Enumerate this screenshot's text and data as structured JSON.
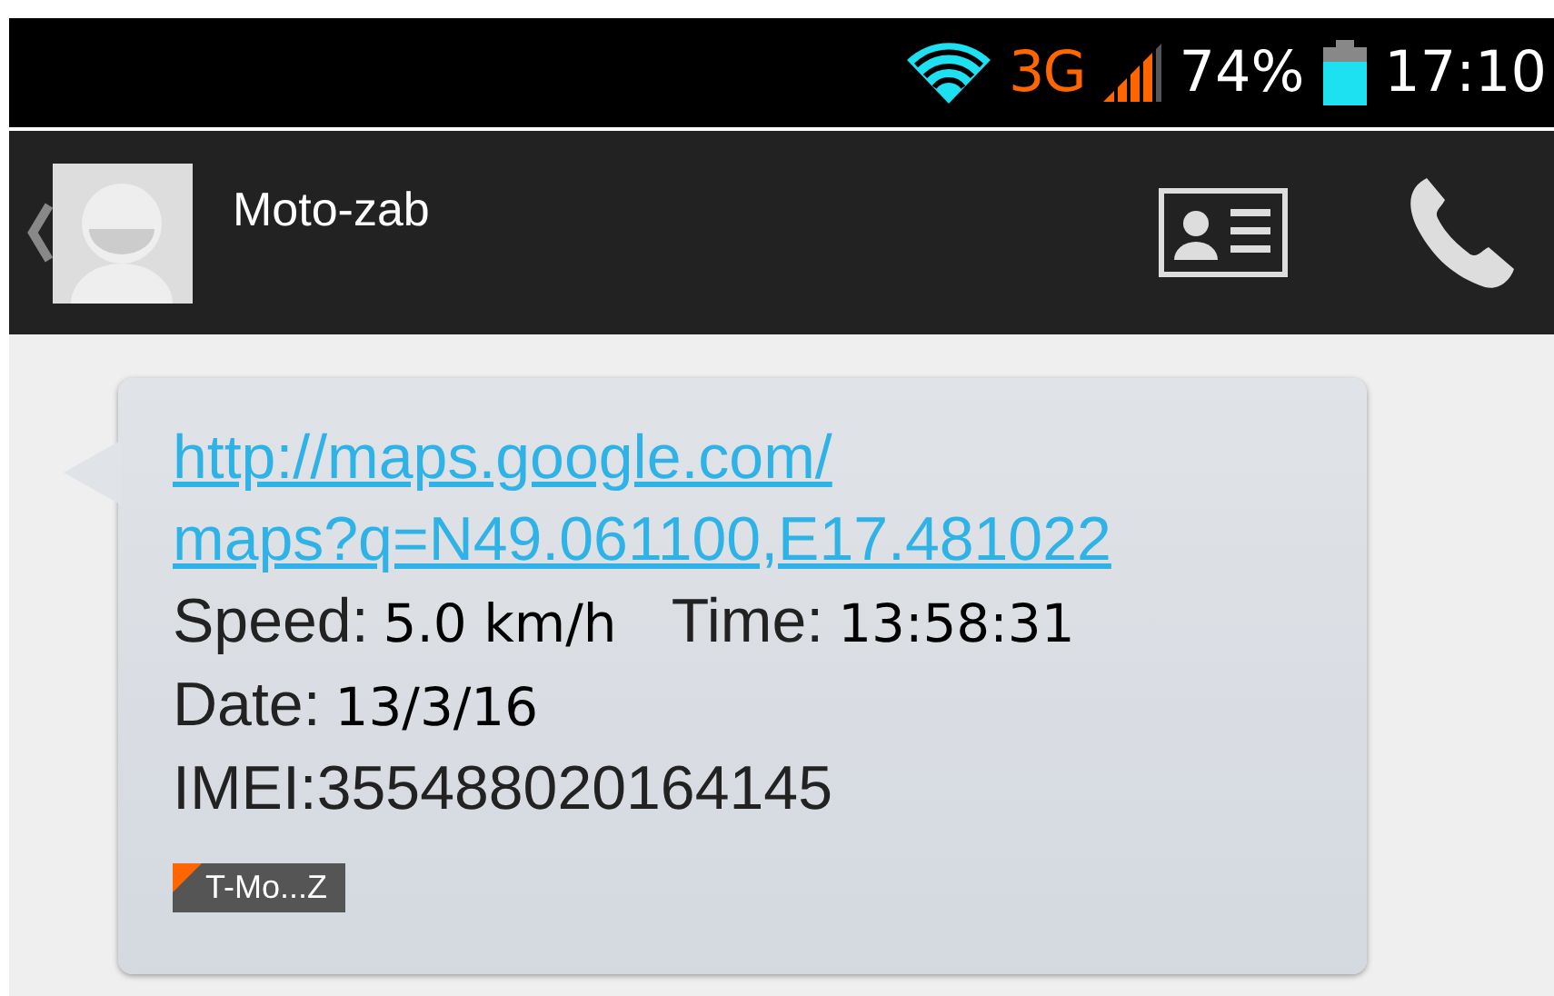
{
  "status_bar": {
    "network": "3G",
    "battery": "74%",
    "time": "17:10"
  },
  "header": {
    "contact": "Moto-zab"
  },
  "message": {
    "link_lines": [
      "http://maps.google.com/",
      "maps?q=N49.061100,E17.481022"
    ],
    "lines": [
      [
        {
          "text": "Speed:",
          "kind": "label"
        },
        {
          "text": "5.0 km/h",
          "kind": "value"
        },
        {
          "text": "Time:",
          "kind": "label"
        },
        {
          "text": "13:58:31",
          "kind": "value"
        }
      ],
      [
        {
          "text": "Date:",
          "kind": "label"
        },
        {
          "text": "13/3/16",
          "kind": "value"
        }
      ],
      [
        {
          "text": "IMEI:355488020164145",
          "kind": "label"
        }
      ]
    ],
    "sim_label": "T-Mo...Z"
  }
}
